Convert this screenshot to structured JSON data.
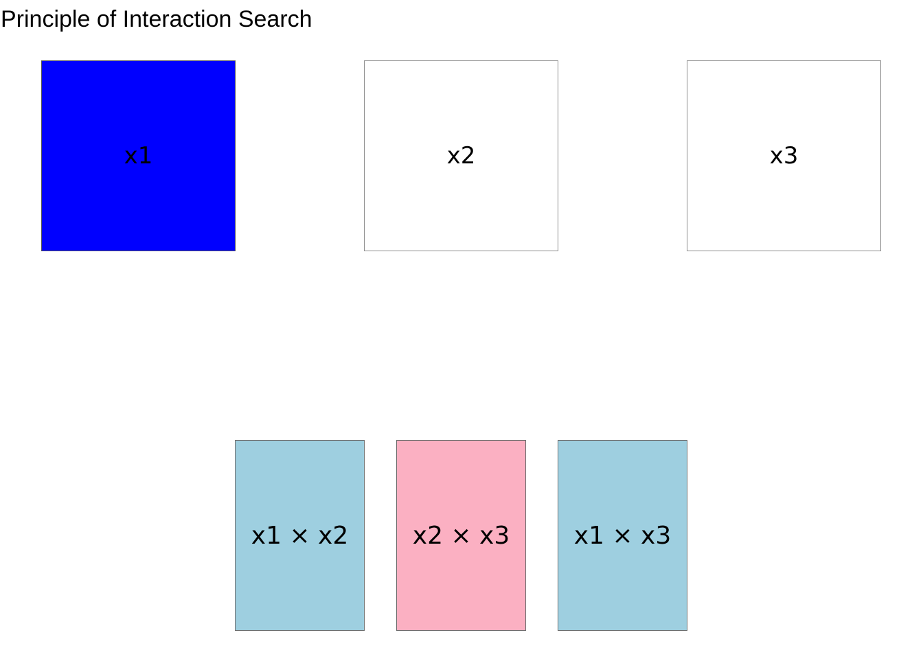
{
  "title": "Principle of Interaction Search",
  "features": [
    {
      "label": "x1",
      "color": "#0000ff"
    },
    {
      "label": "x2",
      "color": "#ffffff"
    },
    {
      "label": "x3",
      "color": "#ffffff"
    }
  ],
  "interactions": [
    {
      "label": "x1 × x2",
      "color": "#9ecfe0"
    },
    {
      "label": "x2 × x3",
      "color": "#fbb0c2"
    },
    {
      "label": "x1 × x3",
      "color": "#9ecfe0"
    }
  ]
}
